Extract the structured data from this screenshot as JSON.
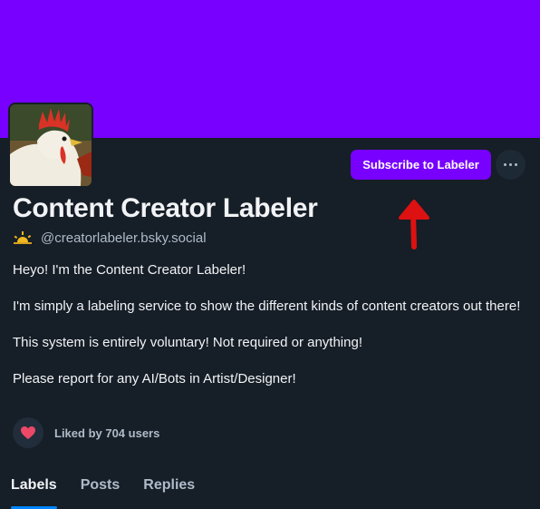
{
  "profile": {
    "display_name": "Content Creator Labeler",
    "handle": "@creatorlabeler.bsky.social",
    "bio": [
      "Heyo! I'm the Content Creator Labeler!",
      "I'm simply a labeling service to show the different kinds of content creators out there!",
      "This system is entirely voluntary! Not required or anything!",
      "Please report for any AI/Bots in Artist/Designer!"
    ],
    "liked_text": "Liked by 704 users"
  },
  "actions": {
    "subscribe_label": "Subscribe to Labeler",
    "more_icon": "ellipsis-icon"
  },
  "tabs": [
    {
      "label": "Labels",
      "active": true
    },
    {
      "label": "Posts",
      "active": false
    },
    {
      "label": "Replies",
      "active": false
    }
  ],
  "colors": {
    "banner": "#7700ff",
    "background": "#161e27",
    "button": "#7700ff",
    "heart": "#ec4868",
    "tab_underline": "#0085ff",
    "annotation_arrow": "#dd1111"
  }
}
